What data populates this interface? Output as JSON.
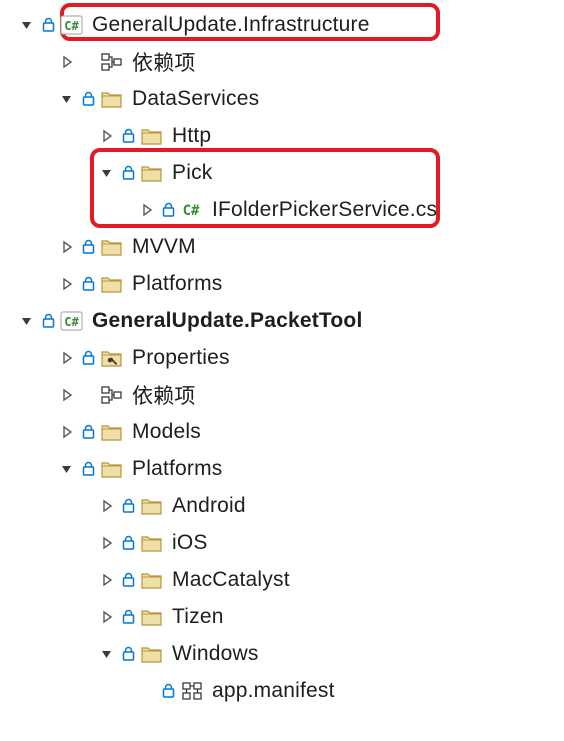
{
  "tree": {
    "project1": {
      "name": "GeneralUpdate.Infrastructure",
      "deps": "依赖项",
      "dataservices": "DataServices",
      "http": "Http",
      "pick": "Pick",
      "ifolder": "IFolderPickerService.cs",
      "mvvm": "MVVM",
      "platforms": "Platforms"
    },
    "project2": {
      "name": "GeneralUpdate.PacketTool",
      "properties": "Properties",
      "deps": "依赖项",
      "models": "Models",
      "platforms": "Platforms",
      "android": "Android",
      "ios": "iOS",
      "maccatalyst": "MacCatalyst",
      "tizen": "Tizen",
      "windows": "Windows",
      "appmanifest": "app.manifest"
    }
  },
  "colors": {
    "highlight": "#e01b24",
    "lock": "#0078d4",
    "folder_fill": "#e8d28b",
    "folder_stroke": "#b8953f",
    "cs_green": "#388a34"
  }
}
